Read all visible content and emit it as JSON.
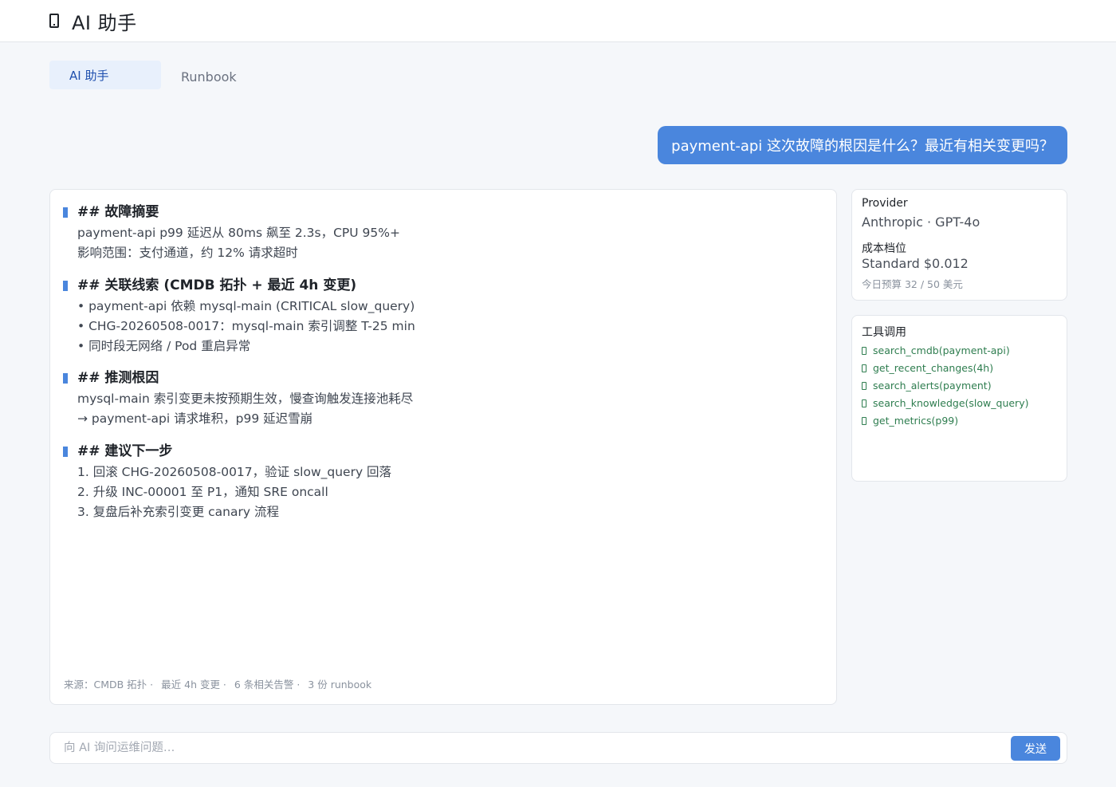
{
  "header": {
    "title": "AI 助手"
  },
  "tabs": [
    {
      "label": "AI 助手",
      "active": true
    },
    {
      "label": "Runbook",
      "active": false
    }
  ],
  "user_message": "payment-api 这次故障的根因是什么？最近有相关变更吗？",
  "answer": {
    "sections": [
      {
        "title": "## 故障摘要",
        "lines": [
          "payment-api p99 延迟从 80ms 飙至 2.3s，CPU 95%+",
          "影响范围：支付通道，约 12% 请求超时"
        ]
      },
      {
        "title": "## 关联线索 (CMDB 拓扑 + 最近 4h 变更)",
        "lines": [
          "• payment-api 依赖 mysql-main (CRITICAL slow_query)",
          "• CHG-20260508-0017：mysql-main 索引调整  T-25 min",
          "• 同时段无网络 / Pod 重启异常"
        ]
      },
      {
        "title": "## 推测根因",
        "lines": [
          "mysql-main 索引变更未按预期生效，慢查询触发连接池耗尽",
          "→ payment-api 请求堆积，p99 延迟雪崩"
        ]
      },
      {
        "title": "## 建议下一步",
        "lines": [
          "1. 回滚 CHG-20260508-0017，验证 slow_query 回落",
          "2. 升级 INC-00001 至 P1，通知 SRE oncall",
          "3. 复盘后补充索引变更 canary 流程"
        ]
      }
    ],
    "sources": [
      "来源：CMDB 拓扑 ·",
      "最近 4h 变更 ·",
      "6 条相关告警 ·",
      "3 份 runbook"
    ]
  },
  "provider": {
    "label": "Provider",
    "value": "Anthropic ·   GPT-4o",
    "cost_label": "成本档位",
    "cost_value": "Standard  $0.012",
    "budget": "今日预算 32 / 50 美元"
  },
  "tools": {
    "label": "工具调用",
    "items": [
      "search_cmdb(payment-api)",
      "get_recent_changes(4h)",
      "search_alerts(payment)",
      "search_knowledge(slow_query)",
      "get_metrics(p99)"
    ]
  },
  "input": {
    "placeholder": "向 AI 询问运维问题…",
    "value": "",
    "send_label": "发送"
  },
  "colors": {
    "accent": "#4a86dd",
    "tool_text": "#2e7d4f",
    "background": "#f5f7fa"
  }
}
